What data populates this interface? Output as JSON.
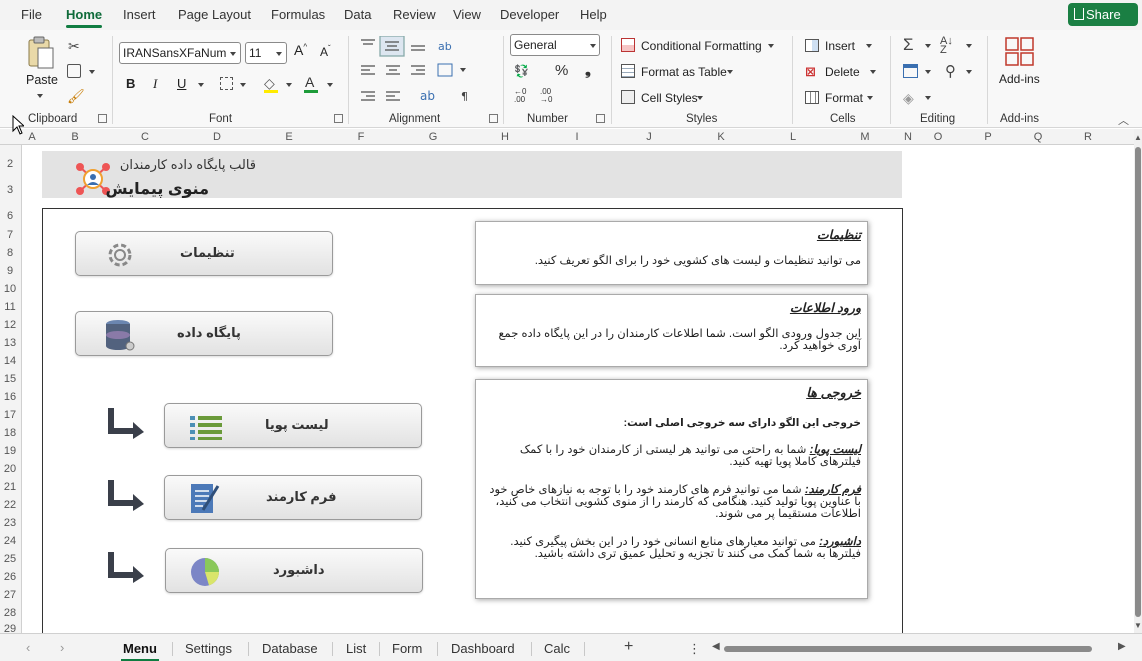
{
  "menubar": {
    "tabs": [
      "File",
      "Home",
      "Insert",
      "Page Layout",
      "Formulas",
      "Data",
      "Review",
      "View",
      "Developer",
      "Help"
    ],
    "active": "Home",
    "share_label": "Share"
  },
  "ribbon": {
    "clipboard": {
      "label": "Clipboard",
      "paste": "Paste"
    },
    "font": {
      "label": "Font",
      "name": "IRANSansXFaNum",
      "size": "11",
      "bold": "B",
      "italic": "I",
      "underline": "U"
    },
    "alignment": {
      "label": "Alignment"
    },
    "number": {
      "label": "Number",
      "format": "General"
    },
    "styles": {
      "label": "Styles",
      "conditional": "Conditional Formatting",
      "format_table": "Format as Table",
      "cell_styles": "Cell Styles"
    },
    "cells": {
      "label": "Cells",
      "insert": "Insert",
      "delete": "Delete",
      "format": "Format"
    },
    "editing": {
      "label": "Editing"
    },
    "addins": {
      "label": "Add-ins",
      "button": "Add-ins"
    }
  },
  "columns": [
    "A",
    "B",
    "C",
    "D",
    "E",
    "F",
    "G",
    "H",
    "I",
    "J",
    "K",
    "L",
    "M",
    "N",
    "O",
    "P",
    "Q",
    "R"
  ],
  "rows": [
    "2",
    "3",
    "6",
    "7",
    "8",
    "9",
    "10",
    "11",
    "12",
    "13",
    "14",
    "15",
    "16",
    "17",
    "18",
    "19",
    "20",
    "21",
    "22",
    "23",
    "24",
    "25",
    "26",
    "27",
    "28",
    "29"
  ],
  "banner": {
    "subtitle": "قالب پایگاه داده کارمندان",
    "title": "منوی پیمایش"
  },
  "nav_buttons": {
    "settings": "تنظیمات",
    "database": "پایگاه داده",
    "list": "لیست پویا",
    "form": "فرم کارمند",
    "dashboard": "داشبورد"
  },
  "panels": {
    "settings": {
      "title": "تنظیمات",
      "text": "می توانید تنظیمات و لیست های کشویی خود را برای الگو تعریف کنید."
    },
    "input": {
      "title": "ورود اطلاعات",
      "text": "این جدول ورودی الگو است. شما اطلاعات کارمندان را در این پایگاه داده جمع آوری خواهید کرد."
    },
    "outputs": {
      "title": "خروجی ها",
      "intro": "خروجی این الگو دارای سه خروجی اصلی است:",
      "list_title": "لیست پویا:",
      "list_text": " شما به راحتی می توانید هر لیستی از کارمندان خود را با کمک فیلترهای کاملا پویا تهیه کنید.",
      "form_title": "فرم کارمند:",
      "form_text": " شما می توانید فرم های کارمند خود را با توجه به نیازهای خاص خود با عناوین پویا تولید کنید. هنگامی که کارمند را از منوی کشویی انتخاب می کنید، اطلاعات مستقیما پر می شوند.",
      "dash_title": "داشبورد:",
      "dash_text": " می توانید معیارهای منابع انسانی خود را در این بخش پیگیری کنید. فیلترها به شما کمک می کنند تا تجزیه و تحلیل عمیق تری داشته باشید."
    }
  },
  "sheet_tabs": [
    "Menu",
    "Settings",
    "Database",
    "List",
    "Form",
    "Dashboard",
    "Calc"
  ],
  "active_sheet": "Menu",
  "add_sheet": "+",
  "more": "⋮"
}
